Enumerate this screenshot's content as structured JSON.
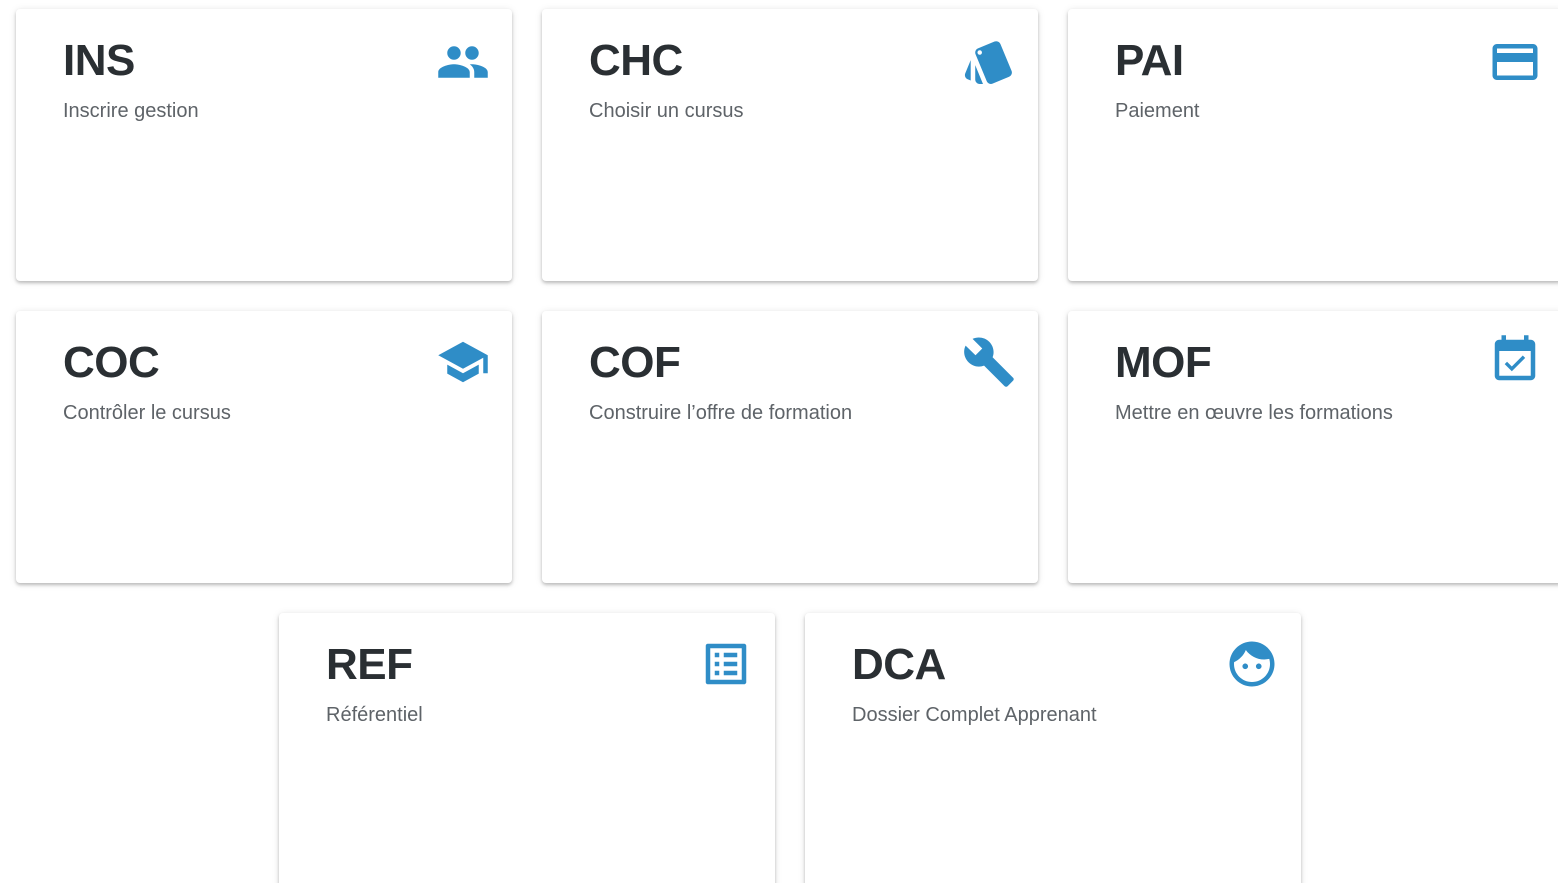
{
  "theme": {
    "accent": "#2f8dc7",
    "title_color": "#2a2f33",
    "desc_color": "#5e6368"
  },
  "cards": [
    {
      "code": "INS",
      "description": "Inscrire gestion",
      "icon": "group-icon"
    },
    {
      "code": "CHC",
      "description": "Choisir un cursus",
      "icon": "style-icon"
    },
    {
      "code": "PAI",
      "description": "Paiement",
      "icon": "credit-card-icon"
    },
    {
      "code": "COC",
      "description": "Contrôler le cursus",
      "icon": "school-icon"
    },
    {
      "code": "COF",
      "description": "Construire l’offre de formation",
      "icon": "wrench-icon"
    },
    {
      "code": "MOF",
      "description": "Mettre en œuvre les formations",
      "icon": "event-available-icon"
    },
    {
      "code": "REF",
      "description": "Référentiel",
      "icon": "list-icon"
    },
    {
      "code": "DCA",
      "description": "Dossier Complet Apprenant",
      "icon": "face-icon"
    }
  ]
}
